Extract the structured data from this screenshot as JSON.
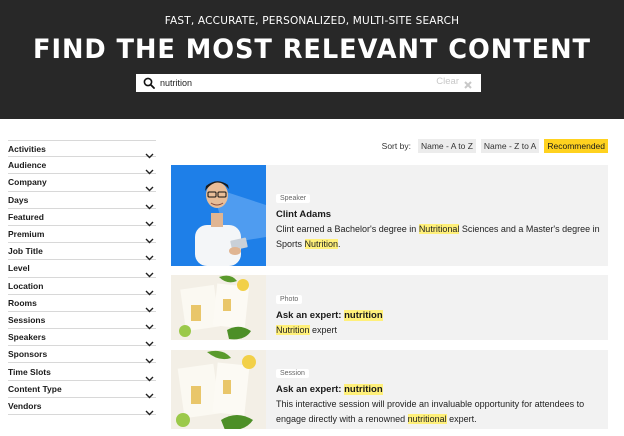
{
  "header": {
    "subtitle": "FAST, ACCURATE, PERSONALIZED, MULTI-SITE SEARCH",
    "title": "FIND THE MOST RELEVANT CONTENT"
  },
  "search": {
    "value": "nutrition",
    "clear_label": "Clear"
  },
  "filters": [
    {
      "label": "Activities"
    },
    {
      "label": "Audience"
    },
    {
      "label": "Company"
    },
    {
      "label": "Days"
    },
    {
      "label": "Featured"
    },
    {
      "label": "Premium"
    },
    {
      "label": "Job Title"
    },
    {
      "label": "Level"
    },
    {
      "label": "Location"
    },
    {
      "label": "Rooms"
    },
    {
      "label": "Sessions"
    },
    {
      "label": "Speakers"
    },
    {
      "label": "Sponsors"
    },
    {
      "label": "Time Slots"
    },
    {
      "label": "Content Type"
    },
    {
      "label": "Vendors"
    }
  ],
  "sort": {
    "label": "Sort by:",
    "options": [
      {
        "label": "Name - A to Z",
        "active": false
      },
      {
        "label": "Name - Z to A",
        "active": false
      },
      {
        "label": "Recommended",
        "active": true
      }
    ]
  },
  "results": [
    {
      "type": "Speaker",
      "title_parts": [
        {
          "text": "Clint Adams",
          "hl": false
        }
      ],
      "desc_parts": [
        {
          "text": "Clint earned a Bachelor's degree in ",
          "hl": false
        },
        {
          "text": "Nutritional",
          "hl": true
        },
        {
          "text": " Sciences and a Master's degree in Sports ",
          "hl": false
        },
        {
          "text": "Nutrition",
          "hl": true
        },
        {
          "text": ".",
          "hl": false
        }
      ]
    },
    {
      "type": "Photo",
      "title_parts": [
        {
          "text": "Ask an expert: ",
          "hl": false
        },
        {
          "text": "nutrition",
          "hl": true
        }
      ],
      "desc_parts": [
        {
          "text": "Nutrition",
          "hl": true
        },
        {
          "text": " expert",
          "hl": false
        }
      ]
    },
    {
      "type": "Session",
      "title_parts": [
        {
          "text": "Ask an expert: ",
          "hl": false
        },
        {
          "text": "nutrition",
          "hl": true
        }
      ],
      "desc_parts": [
        {
          "text": "This interactive session will provide an invaluable opportunity for attendees to engage directly with a renowned ",
          "hl": false
        },
        {
          "text": "nutritional",
          "hl": true
        },
        {
          "text": " expert.",
          "hl": false
        }
      ]
    }
  ],
  "colors": {
    "header_bg": "#282828",
    "accent_yellow": "#ffd21f",
    "highlight": "#fff07a",
    "speaker_bg": "#1e7fe8"
  },
  "icons": [
    "search-icon",
    "clear-icon",
    "chevron-down-icon"
  ]
}
